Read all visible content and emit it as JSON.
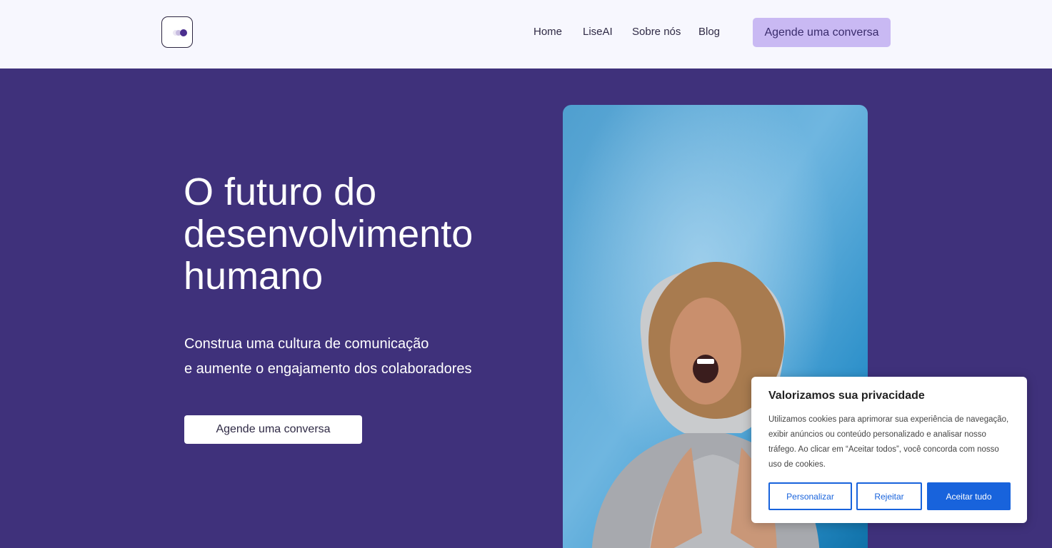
{
  "header": {
    "nav": {
      "home": "Home",
      "liseai": "LiseAI",
      "sobre": "Sobre nós",
      "blog": "Blog"
    },
    "cta_label": "Agende uma conversa"
  },
  "hero": {
    "title": "O futuro do desenvolvimento humano",
    "subtitle_line1": "Construa uma cultura de comunicação",
    "subtitle_line2": "e aumente o engajamento dos colaboradores",
    "cta_label": "Agende uma conversa"
  },
  "cookie_banner": {
    "title": "Valorizamos sua privacidade",
    "text": "Utilizamos cookies para aprimorar sua experiência de navegação, exibir anúncios ou conteúdo personalizado e analisar nosso tráfego. Ao clicar em “Aceitar todos”, você concorda com nosso uso de cookies.",
    "customize_label": "Personalizar",
    "reject_label": "Rejeitar",
    "accept_label": "Aceitar tudo"
  },
  "colors": {
    "hero_bg": "#3f317b",
    "header_bg": "#f7f7fe",
    "header_cta_bg": "#c9b9f3",
    "cookie_accent": "#1863dc"
  },
  "icons": {
    "logo": "toggle-dots-logo"
  }
}
